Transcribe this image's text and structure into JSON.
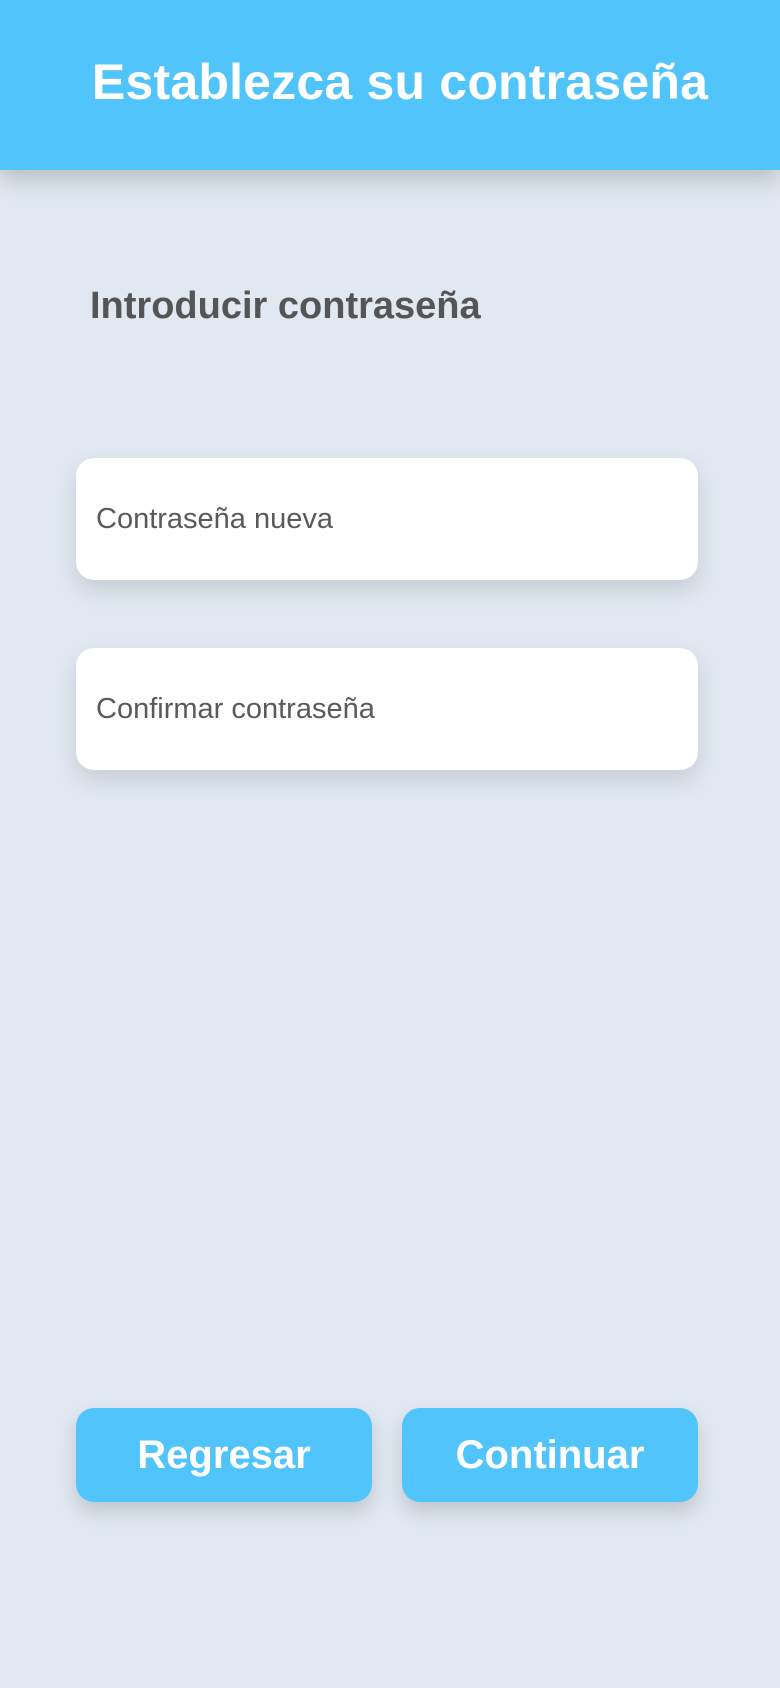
{
  "header": {
    "title": "Establezca su contraseña"
  },
  "section": {
    "title": "Introducir contraseña"
  },
  "fields": {
    "new_password": {
      "placeholder": "Contraseña nueva",
      "value": ""
    },
    "confirm_password": {
      "placeholder": "Confirmar contraseña",
      "value": ""
    }
  },
  "buttons": {
    "back_label": "Regresar",
    "continue_label": "Continuar"
  },
  "colors": {
    "accent": "#50c4fb",
    "background": "#e1e8f1",
    "field_background": "#ffffff",
    "text_dark": "#555555"
  }
}
